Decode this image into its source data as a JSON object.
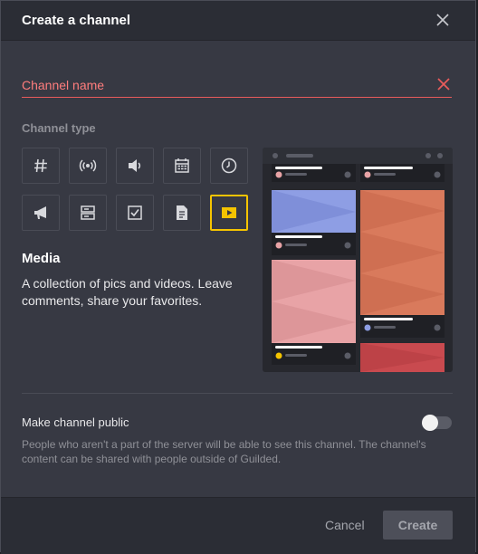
{
  "dialog": {
    "title": "Create a channel"
  },
  "name_input": {
    "placeholder": "Channel name",
    "value": ""
  },
  "channel_type": {
    "label": "Channel type",
    "types": [
      {
        "icon": "hash-icon"
      },
      {
        "icon": "broadcast-icon"
      },
      {
        "icon": "speaker-icon"
      },
      {
        "icon": "calendar-icon"
      },
      {
        "icon": "clock-icon"
      },
      {
        "icon": "megaphone-icon"
      },
      {
        "icon": "list-icon"
      },
      {
        "icon": "checkbox-icon"
      },
      {
        "icon": "document-icon"
      },
      {
        "icon": "media-play-icon",
        "selected": true
      }
    ],
    "selected_name": "Media",
    "selected_description": "A collection of pics and videos. Leave comments, share your favorites."
  },
  "public": {
    "label": "Make channel public",
    "enabled": false,
    "description": "People who aren't a part of the server will be able to see this channel. The channel's content can be shared with people outside of Guilded."
  },
  "footer": {
    "cancel_label": "Cancel",
    "create_label": "Create"
  },
  "colors": {
    "accent": "#f5c400",
    "error": "#e85b5b",
    "preview_blue": "#8e9ee4",
    "preview_orange": "#d97a5c",
    "preview_pink": "#e8a3a6",
    "preview_red": "#c94a4f"
  }
}
